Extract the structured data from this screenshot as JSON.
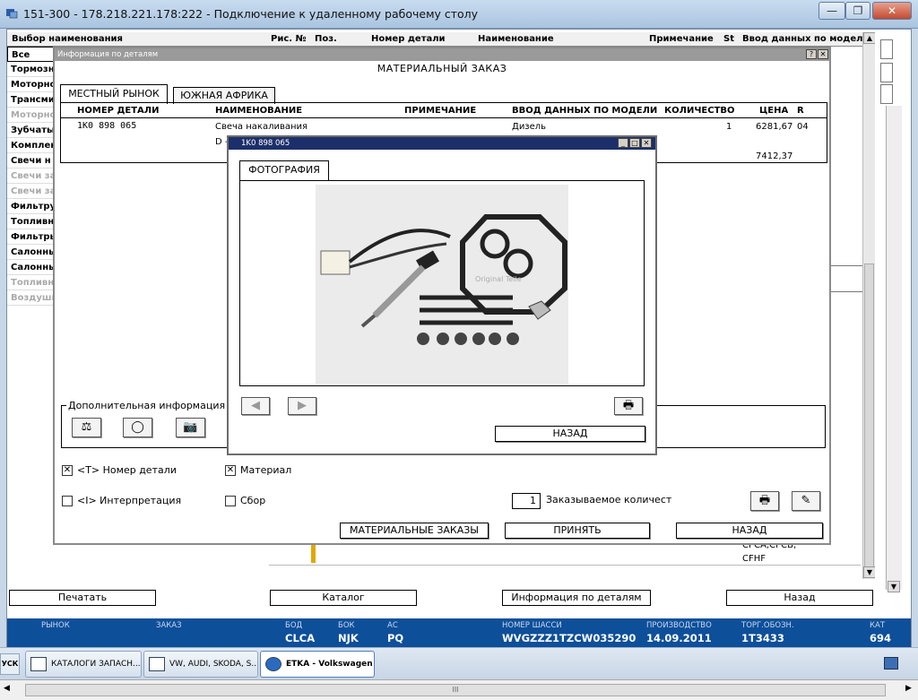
{
  "window": {
    "title": "151-300 - 178.218.221.178:222 - Подключение к удаленному рабочему столу",
    "minimize_glyph": "—",
    "restore_glyph": "❐",
    "close_glyph": "✕"
  },
  "main_header": {
    "col_select": "Выбор наименования",
    "col_fig": "Рис. №",
    "col_pos": "Поз.",
    "col_partno": "Номер детали",
    "col_name": "Наименование",
    "col_note": "Примечание",
    "col_st": "St",
    "col_model": "Ввод данных по модели"
  },
  "left_list": [
    {
      "label": "Все",
      "state": "selected"
    },
    {
      "label": "Тормозн",
      "state": "normal"
    },
    {
      "label": "Моторно",
      "state": "normal"
    },
    {
      "label": "Трансми",
      "state": "normal"
    },
    {
      "label": "Моторно",
      "state": "grey"
    },
    {
      "label": "Зубчаты",
      "state": "normal"
    },
    {
      "label": "Комплек",
      "state": "normal"
    },
    {
      "label": "Свечи н",
      "state": "normal"
    },
    {
      "label": "Свечи за",
      "state": "grey"
    },
    {
      "label": "Свечи за",
      "state": "grey"
    },
    {
      "label": "Фильтру",
      "state": "normal"
    },
    {
      "label": "Топливн",
      "state": "normal"
    },
    {
      "label": "Фильтры",
      "state": "normal"
    },
    {
      "label": "Салонны",
      "state": "normal"
    },
    {
      "label": "Салонны",
      "state": "normal"
    },
    {
      "label": "Топливн",
      "state": "grey"
    },
    {
      "label": "Воздушн",
      "state": "grey"
    }
  ],
  "background_right": {
    "cell1": "СГСА,СГСБ,",
    "cell2": "CFHF"
  },
  "details_dialog": {
    "bar_title": "Информация по деталям",
    "help_glyph": "?",
    "close_glyph": "✕",
    "title": "МАТЕРИАЛЬНЫЙ ЗАКАЗ",
    "tabs": [
      {
        "label": "МЕСТНЫЙ РЫНОК",
        "active": true
      },
      {
        "label": "ЮЖНАЯ АФРИКА",
        "active": false
      }
    ],
    "columns": {
      "partno": "НОМЕР ДЕТАЛИ",
      "name": "НАИМЕНОВАНИЕ",
      "note": "ПРИМЕЧАНИЕ",
      "model": "ВВОД ДАННЫХ ПО МОДЕЛИ",
      "qty": "КОЛИЧЕСТВО",
      "price": "ЦЕНА",
      "r": "R"
    },
    "row": {
      "partno": "1K0 898 065",
      "name": "Свеча накаливания",
      "name2": "D -",
      "model": "Дизель",
      "qty": "1",
      "price": "6281,67",
      "r": "04",
      "price2": "7412,37"
    },
    "extra_info_label": "Дополнительная информация",
    "checks": [
      {
        "label": "<T> Номер детали",
        "checked": true
      },
      {
        "label": "Материал",
        "checked": true
      },
      {
        "label": "<I> Интерпретация",
        "checked": false
      },
      {
        "label": "Сбор",
        "checked": false
      }
    ],
    "order_qty_value": "1",
    "order_qty_label": "Заказываемое количест",
    "buttons": {
      "orders": "МАТЕРИАЛЬНЫЕ ЗАКАЗЫ",
      "accept": "ПРИНЯТЬ",
      "back": "НАЗАД"
    }
  },
  "photo_window": {
    "bar_title": "1K0 898 065",
    "tab_label": "ФОТОГРАФИЯ",
    "watermark": "Original Teile",
    "back_button": "НАЗАД"
  },
  "bottom_buttons": {
    "print": "Печатать",
    "catalog": "Каталог",
    "details": "Информация по деталям",
    "back": "Назад"
  },
  "status_bar": [
    {
      "label": "РЫНОК",
      "value": ""
    },
    {
      "label": "ЗАКАЗ",
      "value": ""
    },
    {
      "label": "БОД",
      "value": "CLCA"
    },
    {
      "label": "БОК",
      "value": "NJK"
    },
    {
      "label": "АС",
      "value": "PQ"
    },
    {
      "label": "НОМЕР ШАССИ",
      "value": "WVGZZZ1TZCW035290"
    },
    {
      "label": "ПРОИЗВОДСТВО",
      "value": "14.09.2011"
    },
    {
      "label": "ТОРГ.ОБОЗН.",
      "value": "1T3433"
    },
    {
      "label": "КАТ",
      "value": "694"
    }
  ],
  "taskbar": {
    "start_label": "УСК",
    "tasks": [
      {
        "label": "КАТАЛОГИ ЗАПАСН...",
        "active": false
      },
      {
        "label": "VW, AUDI, SKODA, S...",
        "active": false
      },
      {
        "label": "ETKA - Volkswagen",
        "active": true
      }
    ]
  },
  "hscroll_grip": "III"
}
